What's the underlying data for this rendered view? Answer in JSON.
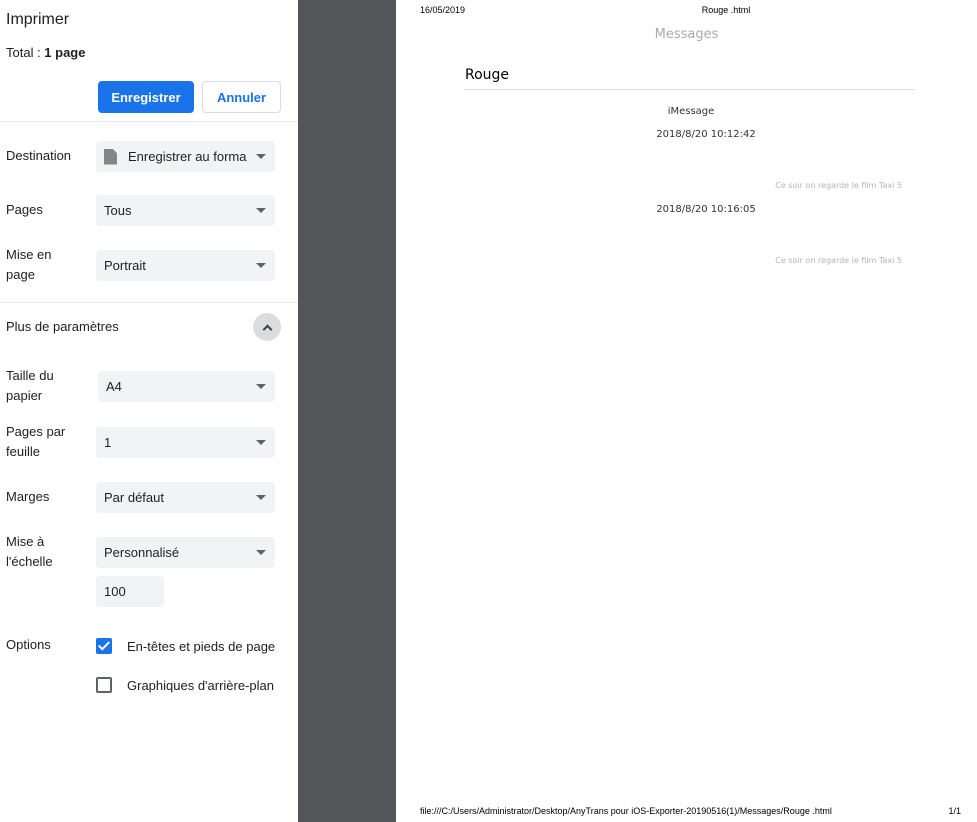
{
  "print_panel": {
    "title": "Imprimer",
    "total_label": "Total : ",
    "total_value": "1 page",
    "save_label": "Enregistrer",
    "cancel_label": "Annuler",
    "destination": {
      "label": "Destination",
      "value": "Enregistrer au format PDF",
      "visible_value": "Enregistrer au forma",
      "icon": "document-icon"
    },
    "pages": {
      "label": "Pages",
      "value": "Tous"
    },
    "layout": {
      "label": "Mise en page",
      "value": "Portrait"
    },
    "more_settings": {
      "label": "Plus de paramètres",
      "expanded": true
    },
    "paper_size": {
      "label": "Taille du papier",
      "value": "A4"
    },
    "pages_per_sheet": {
      "label": "Pages par feuille",
      "value": "1"
    },
    "margins": {
      "label": "Marges",
      "value": "Par défaut"
    },
    "scale": {
      "label": "Mise à l'échelle",
      "value": "Personnalisé",
      "custom_value": "100"
    },
    "options": {
      "label": "Options",
      "headers_footers": {
        "label": "En-têtes et pieds de page",
        "checked": true
      },
      "background_graphics": {
        "label": "Graphiques d'arrière-plan",
        "checked": false
      }
    },
    "accent_color": "#1a73e8"
  },
  "preview": {
    "header_date": "16/05/2019",
    "header_title": "Rouge .html",
    "app_title": "Messages",
    "contact": "Rouge",
    "service": "iMessage",
    "messages": [
      {
        "timestamp": "2018/8/20 10:12:42",
        "text": "Ce soir on regarde le film Taxi 5"
      },
      {
        "timestamp": "2018/8/20 10:16:05",
        "text": "Ce soir on regarde le film Taxi 5"
      }
    ],
    "footer_url": "file:///C:/Users/Administrator/Desktop/AnyTrans pour iOS-Exporter-20190516(1)/Messages/Rouge .html",
    "footer_page": "1/1"
  }
}
